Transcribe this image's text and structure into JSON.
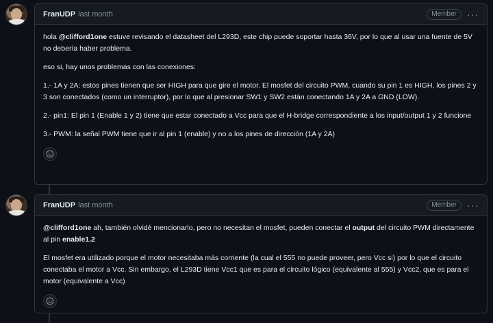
{
  "comments": [
    {
      "author": "FranUDP",
      "time": "last month",
      "badge": "Member",
      "more_icon": "kebab-horizontal-icon",
      "p1_pre": "hola ",
      "p1_mention": "@clifford1one",
      "p1_post": " estuve revisando el datasheet del L293D, este chip puede soportar hasta 36V, por lo que al usar una fuente de 5V no debería haber problema.",
      "p2": "eso si, hay unos problemas con las conexiones:",
      "p3": "1.- 1A y 2A: estos pines tienen que ser HIGH para que gire el motor. El mosfet del circuito PWM, cuando su pin 1 es HIGH, los pines 2 y 3 son conectados (como un interruptor), por lo que al presionar SW1 y SW2 están conectando 1A y 2A a GND (LOW).",
      "p4": "2.- pin1: El pin 1 (Enable 1 y 2) tiene que estar conectado a Vcc para que el H-bridge correspondiente a los input/output 1 y 2 funcione",
      "p5": "3.- PWM: la señal PWM tiene que ir al pin 1 (enable) y no a los pines de dirección (1A y 2A)"
    },
    {
      "author": "FranUDP",
      "time": "last month",
      "badge": "Member",
      "more_icon": "kebab-horizontal-icon",
      "p1_mention": "@clifford1one",
      "p1_a": " ah, también olvidé mencionarlo, pero no necesitan el mosfet, pueden conectar el ",
      "p1_bold1": "output",
      "p1_b": " del circuito PWM directamente al pin ",
      "p1_bold2": "enable1.2",
      "p2": "El mosfet era utilizado porque el motor necesitaba más corriente (la cual el 555 no puede proveer, pero Vcc si) por lo que el circuito conectaba el motor a Vcc. Sin embargo, el L293D tiene Vcc1 que es para el circuito lógico (equivalente al 555) y Vcc2, que es para el motor (equivalente a Vcc)"
    }
  ],
  "icons": {
    "reaction": "smiley-icon",
    "avatar": "user-avatar"
  },
  "colors": {
    "background": "#0d1117",
    "header": "#161b22",
    "border": "#30363d",
    "muted": "#8b949e",
    "text": "#e6edf3"
  }
}
